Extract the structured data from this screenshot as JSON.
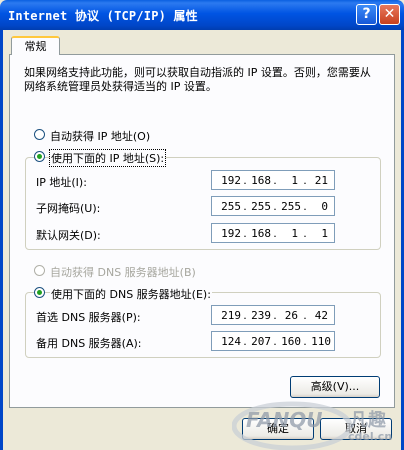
{
  "window": {
    "title": "Internet 协议 (TCP/IP) 属性"
  },
  "titlebar_buttons": {
    "help": "?",
    "close": "✕"
  },
  "tabs": [
    {
      "label": "常规"
    }
  ],
  "description": "如果网络支持此功能，则可以获取自动指派的 IP 设置。否则，您需要从网络系统管理员处获得适当的 IP 设置。",
  "ip_mode": {
    "auto": {
      "label": "自动获得 IP 地址(O)",
      "selected": false
    },
    "manual": {
      "label": "使用下面的 IP 地址(S):",
      "selected": true
    }
  },
  "ip_fields": [
    {
      "label": "IP 地址(I):",
      "octets": [
        "192",
        "168",
        "1",
        "21"
      ]
    },
    {
      "label": "子网掩码(U):",
      "octets": [
        "255",
        "255",
        "255",
        "0"
      ]
    },
    {
      "label": "默认网关(D):",
      "octets": [
        "192",
        "168",
        "1",
        "1"
      ]
    }
  ],
  "dns_mode": {
    "auto": {
      "label": "自动获得 DNS 服务器地址(B)",
      "selected": false,
      "disabled": true
    },
    "manual": {
      "label": "使用下面的 DNS 服务器地址(E):",
      "selected": true
    }
  },
  "dns_fields": [
    {
      "label": "首选 DNS 服务器(P):",
      "octets": [
        "219",
        "239",
        "26",
        "42"
      ]
    },
    {
      "label": "备用 DNS 服务器(A):",
      "octets": [
        "124",
        "207",
        "160",
        "110"
      ]
    }
  ],
  "buttons": {
    "advanced": "高级(V)...",
    "ok": "确定",
    "cancel": "取消"
  },
  "watermark": {
    "brand": "FANQU",
    "cn": "凡趣",
    "url": "cdel.cn"
  },
  "colors": {
    "titlebar": "#0054E3",
    "face": "#ECE9D8",
    "radio_dot": "#21A121",
    "tab_highlight": "#FFC83C"
  }
}
